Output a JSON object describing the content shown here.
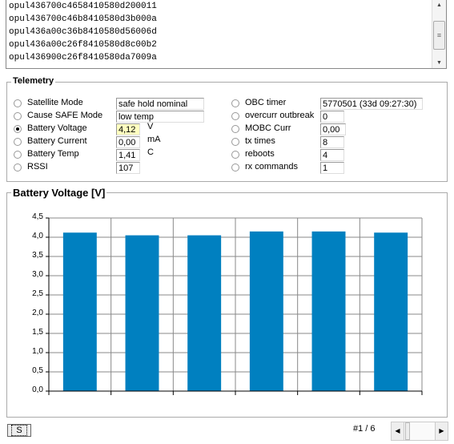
{
  "log": {
    "lines": [
      "opul436700c4658410580d200011",
      "opul436700c46b8410580d3b000a",
      "opul436a00c36b8410580d56006d",
      "opul436a00c26f8410580d8c00b2",
      "opul436900c26f8410580da7009a"
    ]
  },
  "telemetry": {
    "title": "Telemetry",
    "left": [
      {
        "label": "Satellite Mode",
        "value": "safe hold nominal",
        "unit": "",
        "selected": false
      },
      {
        "label": "Cause SAFE Mode",
        "value": "low temp",
        "unit": "",
        "selected": false
      },
      {
        "label": "Battery Voltage",
        "value": "4,12",
        "unit": "V",
        "selected": true
      },
      {
        "label": "Battery Current",
        "value": "0,00",
        "unit": "mA",
        "selected": false
      },
      {
        "label": "Battery Temp",
        "value": "1,41",
        "unit": "C",
        "selected": false
      },
      {
        "label": "RSSI",
        "value": "107",
        "unit": "",
        "selected": false
      }
    ],
    "right": [
      {
        "label": "OBC timer",
        "value": "5770501 (33d 09:27:30)",
        "selected": false
      },
      {
        "label": "overcurr outbreak",
        "value": "0",
        "selected": false
      },
      {
        "label": "MOBC Curr",
        "value": "0,00",
        "selected": false
      },
      {
        "label": "tx times",
        "value": "8",
        "selected": false
      },
      {
        "label": "reboots",
        "value": "4",
        "selected": false
      },
      {
        "label": "rx commands",
        "value": "1",
        "selected": false
      }
    ]
  },
  "chart_data": {
    "type": "bar",
    "title": "Battery Voltage [V]",
    "categories": [
      "",
      "",
      "",
      "",
      "",
      ""
    ],
    "values": [
      4.12,
      4.05,
      4.05,
      4.15,
      4.15,
      4.12
    ],
    "ylim": [
      0,
      4.5
    ],
    "yticks": [
      "0,0",
      "0,5",
      "1,0",
      "1,5",
      "2,0",
      "2,5",
      "3,0",
      "3,5",
      "4,0",
      "4,5"
    ],
    "grid": true,
    "bar_color": "#0080c0"
  },
  "footer": {
    "button_label": "S",
    "page": "#1 / 6"
  }
}
